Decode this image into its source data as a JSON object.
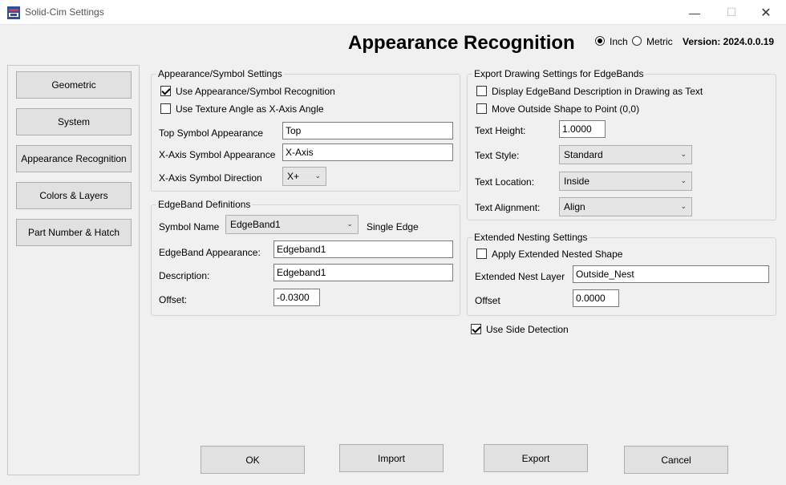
{
  "window": {
    "title": "Solid-Cim Settings",
    "minimize": "—",
    "maximize": "☐",
    "close": "✕"
  },
  "header": {
    "title": "Appearance Recognition",
    "unit_inch": "Inch",
    "unit_metric": "Metric",
    "selected_unit": "Inch",
    "version": "Version: 2024.0.0.19"
  },
  "sidebar": {
    "items": [
      {
        "label": "Geometric"
      },
      {
        "label": "System"
      },
      {
        "label": "Appearance Recognition"
      },
      {
        "label": "Colors & Layers"
      },
      {
        "label": "Part Number & Hatch"
      }
    ]
  },
  "appearance_symbol": {
    "title": "Appearance/Symbol Settings",
    "use_recognition_label": "Use Appearance/Symbol Recognition",
    "use_recognition_checked": true,
    "use_texture_label": "Use Texture Angle as X-Axis Angle",
    "use_texture_checked": false,
    "top_symbol_label": "Top Symbol Appearance",
    "top_symbol_value": "Top",
    "xaxis_symbol_label": "X-Axis Symbol Appearance",
    "xaxis_symbol_value": "X-Axis",
    "xaxis_direction_label": "X-Axis Symbol Direction",
    "xaxis_direction_value": "X+"
  },
  "edgeband": {
    "title": "EdgeBand Definitions",
    "symbol_name_label": "Symbol Name",
    "symbol_name_value": "EdgeBand1",
    "single_edge_label": "Single Edge",
    "appearance_label": "EdgeBand Appearance:",
    "appearance_value": "Edgeband1",
    "description_label": "Description:",
    "description_value": "Edgeband1",
    "offset_label": "Offset:",
    "offset_value": "-0.0300"
  },
  "export_drawing": {
    "title": "Export Drawing Settings for EdgeBands",
    "display_desc_label": "Display EdgeBand Description in Drawing as Text",
    "display_desc_checked": false,
    "move_outside_label": "Move Outside Shape to Point (0,0)",
    "move_outside_checked": false,
    "text_height_label": "Text Height:",
    "text_height_value": "1.0000",
    "text_style_label": "Text Style:",
    "text_style_value": "Standard",
    "text_location_label": "Text Location:",
    "text_location_value": "Inside",
    "text_alignment_label": "Text Alignment:",
    "text_alignment_value": "Align"
  },
  "extended_nesting": {
    "title": "Extended Nesting Settings",
    "apply_label": "Apply Extended Nested Shape",
    "apply_checked": false,
    "nest_layer_label": "Extended Nest Layer",
    "nest_layer_value": "Outside_Nest",
    "offset_label": "Offset",
    "offset_value": "0.0000"
  },
  "side_detection": {
    "label": "Use Side Detection",
    "checked": true
  },
  "buttons": {
    "ok": "OK",
    "import": "Import",
    "export": "Export",
    "cancel": "Cancel"
  },
  "icons": {
    "dropdown": "chevron-down-icon",
    "app": "app-icon"
  }
}
